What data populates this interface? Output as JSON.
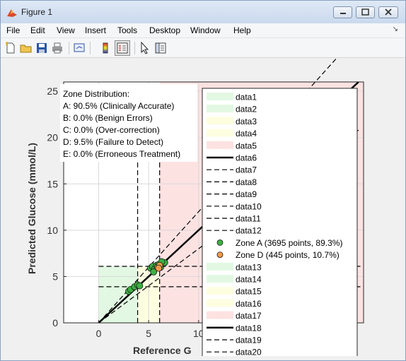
{
  "window": {
    "title": "Figure 1",
    "icon": "matlab-figure-icon",
    "controls": [
      "minimize-icon",
      "maximize-icon",
      "close-icon"
    ]
  },
  "menu": [
    "File",
    "Edit",
    "View",
    "Insert",
    "Tools",
    "Desktop",
    "Window",
    "Help"
  ],
  "toolbar": [
    {
      "name": "new-figure-icon"
    },
    {
      "name": "open-file-icon"
    },
    {
      "name": "save-icon"
    },
    {
      "name": "print-icon"
    },
    {
      "name": "link-plot-icon"
    },
    {
      "name": "insert-colorbar-icon"
    },
    {
      "name": "insert-legend-icon"
    },
    {
      "name": "edit-plot-icon"
    },
    {
      "name": "property-inspector-icon"
    }
  ],
  "annotation": {
    "lines": [
      "Zone Distribution:",
      "A: 90.5% (Clinically Accurate)",
      "B: 0.0% (Benign Errors)",
      "C: 0.0% (Over-correction)",
      "D: 9.5% (Failure to Detect)",
      "E: 0.0% (Erroneous Treatment)"
    ]
  },
  "legend": {
    "entries": [
      {
        "label": "data1",
        "kind": "patch",
        "color": "#e2f8e2"
      },
      {
        "label": "data2",
        "kind": "patch",
        "color": "#e2f8e2"
      },
      {
        "label": "data3",
        "kind": "patch",
        "color": "#fdfde0"
      },
      {
        "label": "data4",
        "kind": "patch",
        "color": "#fdfde0"
      },
      {
        "label": "data5",
        "kind": "patch",
        "color": "#fde2e2"
      },
      {
        "label": "data6",
        "kind": "solid",
        "color": "#000000"
      },
      {
        "label": "data7",
        "kind": "dashed",
        "color": "#000000"
      },
      {
        "label": "data8",
        "kind": "dashed",
        "color": "#000000"
      },
      {
        "label": "data9",
        "kind": "dashed",
        "color": "#000000"
      },
      {
        "label": "data10",
        "kind": "dashed",
        "color": "#000000"
      },
      {
        "label": "data11",
        "kind": "dashed",
        "color": "#000000"
      },
      {
        "label": "data12",
        "kind": "dashed",
        "color": "#000000"
      },
      {
        "label": "Zone A (3695 points, 89.3%)",
        "kind": "marker",
        "color": "#3cb043"
      },
      {
        "label": "Zone D (445 points, 10.7%)",
        "kind": "marker",
        "color": "#f29a4a"
      },
      {
        "label": "data13",
        "kind": "patch",
        "color": "#e2f8e2"
      },
      {
        "label": "data14",
        "kind": "patch",
        "color": "#e2f8e2"
      },
      {
        "label": "data15",
        "kind": "patch",
        "color": "#fdfde0"
      },
      {
        "label": "data16",
        "kind": "patch",
        "color": "#fdfde0"
      },
      {
        "label": "data17",
        "kind": "patch",
        "color": "#fde2e2"
      },
      {
        "label": "data18",
        "kind": "solid",
        "color": "#000000"
      },
      {
        "label": "data19",
        "kind": "dashed",
        "color": "#000000"
      },
      {
        "label": "data20",
        "kind": "dashed",
        "color": "#000000"
      }
    ]
  },
  "chart_data": {
    "type": "scatter",
    "xlabel": "Reference G",
    "ylabel": "Predicted Glucose (mmol/L)",
    "xlim": [
      -3.5,
      26.5
    ],
    "ylim": [
      0,
      26
    ],
    "xticks": [
      0,
      5,
      10
    ],
    "xtick_labels": [
      "0",
      "5",
      "10"
    ],
    "yticks": [
      0,
      5,
      10,
      15,
      20,
      25
    ],
    "ytick_labels": [
      "0",
      "5",
      "10",
      "15",
      "20",
      "25"
    ],
    "grid": true,
    "zones": [
      {
        "name": "A-low",
        "color": "#e2f8e2",
        "x": [
          0,
          3.9
        ],
        "y": [
          0,
          6.1
        ]
      },
      {
        "name": "D-low",
        "color": "#fdfde0",
        "x": [
          3.9,
          6.1
        ],
        "y": [
          0,
          6.1
        ]
      },
      {
        "name": "E-right",
        "color": "#fde2e2",
        "x": [
          6.1,
          26.5
        ],
        "y": [
          0,
          26
        ]
      }
    ],
    "identity_line": {
      "x": [
        0,
        26
      ],
      "y": [
        0,
        26
      ]
    },
    "dashed_lines": [
      {
        "x": [
          0,
          26
        ],
        "y": [
          0,
          31.2
        ]
      },
      {
        "x": [
          0,
          26
        ],
        "y": [
          0,
          20.8
        ]
      },
      {
        "x": [
          3.9,
          3.9
        ],
        "y": [
          0,
          26
        ]
      },
      {
        "x": [
          6.1,
          6.1
        ],
        "y": [
          0,
          26
        ]
      },
      {
        "x": [
          0,
          26.5
        ],
        "y": [
          3.9,
          3.9
        ]
      },
      {
        "x": [
          0,
          26.5
        ],
        "y": [
          6.1,
          6.1
        ]
      }
    ],
    "series": [
      {
        "name": "Zone A (3695 points, 89.3%)",
        "color": "#3cb043",
        "points": [
          [
            3.0,
            3.4
          ],
          [
            3.2,
            3.6
          ],
          [
            3.6,
            3.9
          ],
          [
            3.9,
            4.1
          ],
          [
            4.1,
            4.0
          ],
          [
            5.2,
            5.9
          ],
          [
            5.4,
            6.1
          ],
          [
            5.6,
            5.8
          ],
          [
            5.8,
            6.2
          ],
          [
            6.0,
            6.3
          ],
          [
            6.2,
            6.0
          ],
          [
            6.4,
            6.4
          ],
          [
            6.6,
            6.5
          ],
          [
            5.5,
            5.5
          ],
          [
            6.3,
            6.6
          ]
        ]
      },
      {
        "name": "Zone D (445 points, 10.7%)",
        "color": "#f29a4a",
        "points": [
          [
            5.9,
            6.0
          ],
          [
            6.1,
            6.2
          ],
          [
            6.0,
            5.9
          ]
        ]
      }
    ]
  }
}
